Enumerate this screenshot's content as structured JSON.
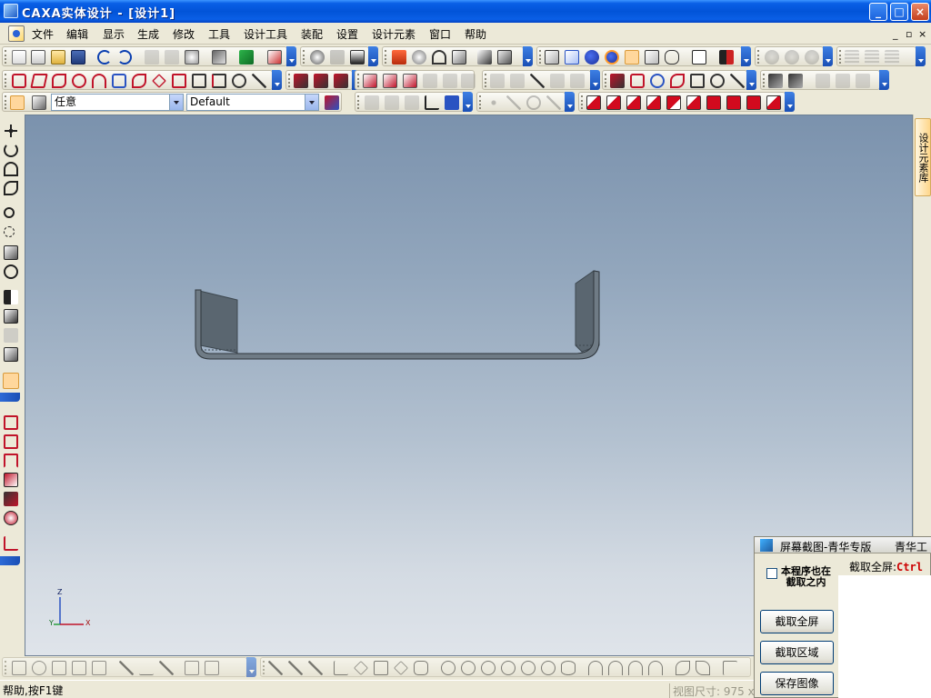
{
  "titlebar": {
    "title": "CAXA实体设计 - [设计1]",
    "min": "_",
    "max": "□",
    "close": "×"
  },
  "menu": {
    "items": [
      "文件",
      "编辑",
      "显示",
      "生成",
      "修改",
      "工具",
      "设计工具",
      "装配",
      "设置",
      "设计元素",
      "窗口",
      "帮助"
    ],
    "doc_controls": [
      "_",
      "▫",
      "×"
    ]
  },
  "selector": {
    "filter_value": "任意",
    "style_value": "Default"
  },
  "right_panel": {
    "tab_label": "设计元素库"
  },
  "axes": {
    "z": "Z",
    "y": "Y",
    "x": "X"
  },
  "statusbar": {
    "help": "帮助,按F1键",
    "viewsize": "视图尺寸: 975 x"
  },
  "capture_tool": {
    "title": "屏幕截图-青华专版",
    "title_extra": "青华工",
    "checkbox_label": "本程序也在截取之内",
    "shortcut_label": "截取全屏:",
    "shortcut_key": "Ctrl",
    "buttons": [
      "截取全屏",
      "截取区域",
      "保存图像"
    ]
  },
  "colors": {
    "titlebar": "#0a5fe6",
    "viewport_top": "#7b92ad",
    "viewport_bottom": "#dfe4ea",
    "part_fill": "#5a6670",
    "accent_tab": "#ffd68a"
  }
}
